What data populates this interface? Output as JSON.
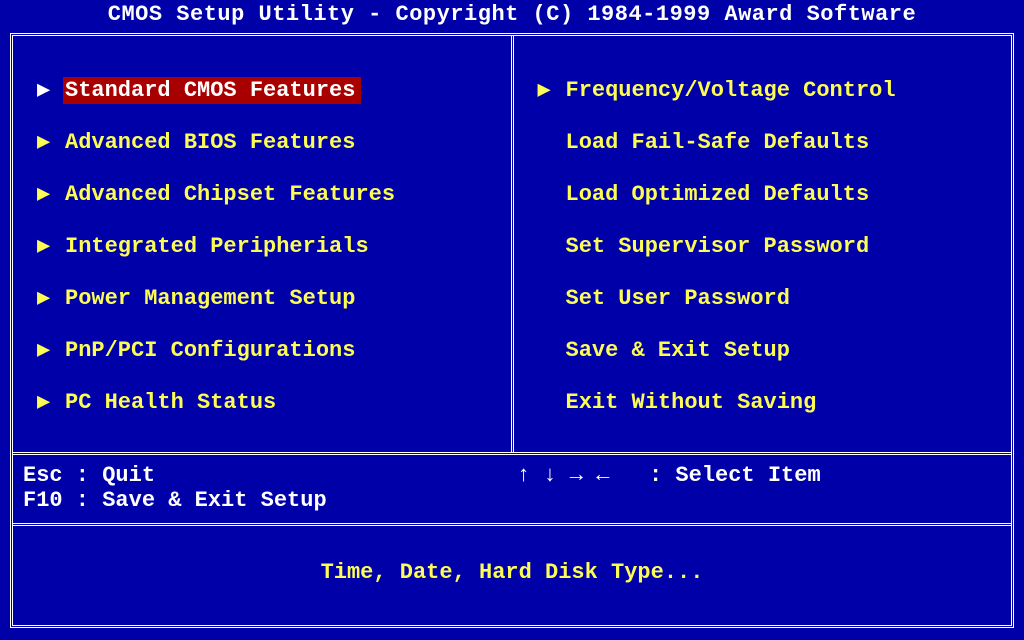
{
  "title": "CMOS Setup Utility - Copyright (C) 1984-1999 Award Software",
  "menu": {
    "left": [
      {
        "label": "Standard CMOS Features",
        "arrow": true
      },
      {
        "label": "Advanced BIOS Features",
        "arrow": true
      },
      {
        "label": "Advanced Chipset Features",
        "arrow": true
      },
      {
        "label": "Integrated Peripherials",
        "arrow": true
      },
      {
        "label": "Power Management Setup",
        "arrow": true
      },
      {
        "label": "PnP/PCI Configurations",
        "arrow": true
      },
      {
        "label": "PC Health Status",
        "arrow": true
      }
    ],
    "right": [
      {
        "label": "Frequency/Voltage Control",
        "arrow": true
      },
      {
        "label": "Load Fail-Safe Defaults",
        "arrow": false
      },
      {
        "label": "Load Optimized Defaults",
        "arrow": false
      },
      {
        "label": "Set Supervisor Password",
        "arrow": false
      },
      {
        "label": "Set User Password",
        "arrow": false
      },
      {
        "label": "Save & Exit Setup",
        "arrow": false
      },
      {
        "label": "Exit Without Saving",
        "arrow": false
      }
    ],
    "selected_index": 0
  },
  "hints": {
    "left1": "Esc : Quit",
    "left2": "F10 : Save & Exit Setup",
    "right1": "↑ ↓ → ←   : Select Item"
  },
  "description": "Time, Date, Hard Disk Type..."
}
